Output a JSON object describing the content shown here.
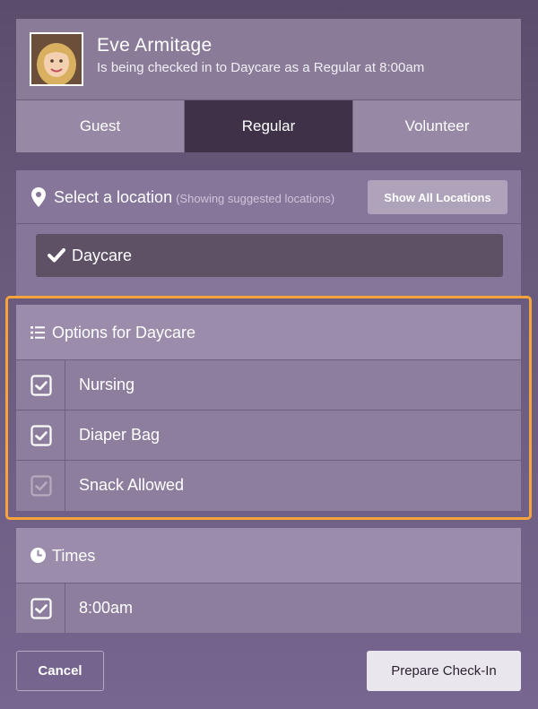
{
  "person": {
    "name": "Eve Armitage",
    "subtitle": "Is being checked in to Daycare as a Regular at 8:00am",
    "avatar_icon": "child-photo"
  },
  "checkin_types": [
    {
      "label": "Guest",
      "active": false
    },
    {
      "label": "Regular",
      "active": true
    },
    {
      "label": "Volunteer",
      "active": false
    }
  ],
  "location": {
    "title": "Select a location",
    "hint": "(Showing suggested locations)",
    "show_all_label": "Show All Locations",
    "selected": "Daycare",
    "icon": "map-pin-icon"
  },
  "options": {
    "title": "Options for Daycare",
    "icon": "list-icon",
    "items": [
      {
        "label": "Nursing",
        "checked": true,
        "disabled": false
      },
      {
        "label": "Diaper Bag",
        "checked": true,
        "disabled": false
      },
      {
        "label": "Snack Allowed",
        "checked": true,
        "disabled": true
      }
    ]
  },
  "times": {
    "title": "Times",
    "icon": "clock-icon",
    "items": [
      {
        "label": "8:00am",
        "checked": true
      }
    ]
  },
  "footer": {
    "cancel_label": "Cancel",
    "prepare_label": "Prepare Check-In"
  },
  "colors": {
    "selected_type": "#3f3148",
    "highlight_border": "#f5a33a",
    "background": "#6a5a7c"
  }
}
